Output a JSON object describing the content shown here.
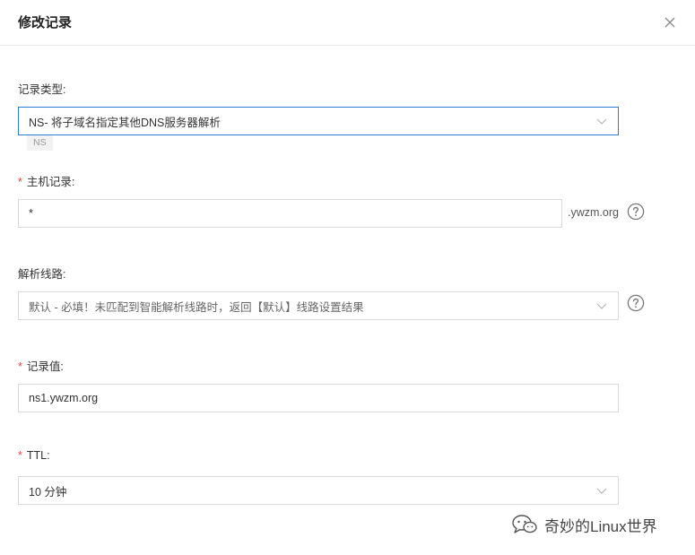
{
  "dialog": {
    "title": "修改记录"
  },
  "record_type": {
    "label": "记录类型",
    "colon": ":",
    "value": "NS- 将子域名指定其他DNS服务器解析",
    "tag": "NS"
  },
  "host": {
    "required": "*",
    "label": "主机记录",
    "colon": ":",
    "value": "*",
    "suffix": ".ywzm.org"
  },
  "line": {
    "label": "解析线路",
    "colon": ":",
    "value": "默认 - 必填！未匹配到智能解析线路时，返回【默认】线路设置结果"
  },
  "record_value": {
    "required": "*",
    "label": "记录值",
    "colon": ":",
    "value": "ns1.ywzm.org"
  },
  "ttl": {
    "required": "*",
    "label": "TTL",
    "colon": ":",
    "value": "10 分钟"
  },
  "watermark": {
    "text": "奇妙的Linux世界"
  },
  "colors": {
    "accent": "#2b7bd9",
    "required": "#e54545",
    "border": "#d9d9d9"
  },
  "icons": {
    "close": "close-icon",
    "chevron": "chevron-down-icon",
    "help": "question-circle-icon",
    "watermark": "wechat-icon"
  }
}
